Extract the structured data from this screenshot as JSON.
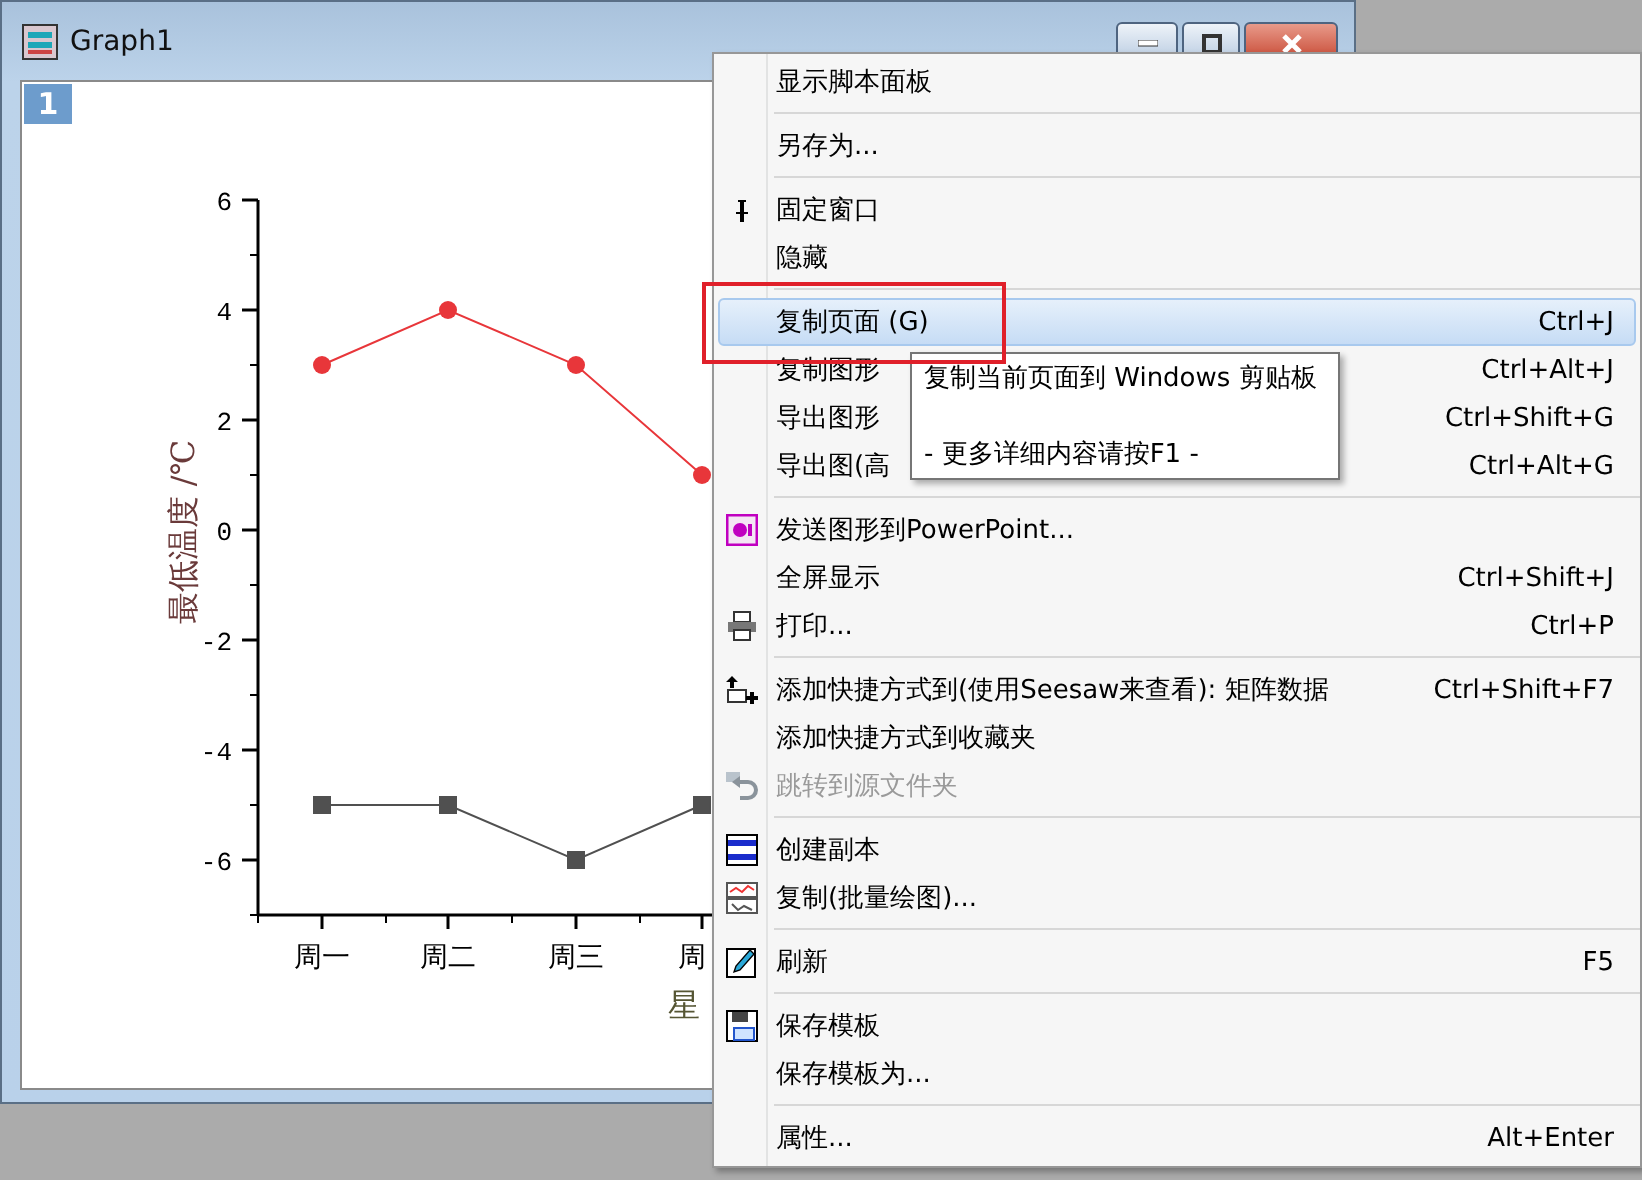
{
  "window": {
    "title": "Graph1",
    "layer": "1"
  },
  "chart": {
    "chart_data": {
      "type": "line",
      "xlabel": "星",
      "ylabel": "最低温度 /℃",
      "categories": [
        "周一",
        "周二",
        "周三",
        "周"
      ],
      "series": [
        {
          "color": "#e8363a",
          "marker": "circle",
          "values": [
            3,
            4,
            3,
            1
          ]
        },
        {
          "color": "#505050",
          "marker": "square",
          "values": [
            -5,
            -5,
            -6,
            -5
          ]
        }
      ],
      "ylim": [
        -7,
        6
      ],
      "yticks": [
        -6,
        -4,
        -2,
        0,
        2,
        4,
        6
      ]
    }
  },
  "menu": {
    "sections": [
      [
        {
          "label": "显示脚本面板",
          "selected": false,
          "disabled": false
        }
      ],
      [
        {
          "label": "另存为...",
          "selected": false,
          "disabled": false
        }
      ],
      [
        {
          "label": "固定窗口",
          "selected": false,
          "disabled": false
        },
        {
          "label": "隐藏",
          "selected": false,
          "disabled": false
        }
      ],
      [
        {
          "label": "复制页面 (G)",
          "shortcut": "Ctrl+J",
          "selected": true,
          "disabled": false
        },
        {
          "label": "复制图形",
          "shortcut": "Ctrl+Alt+J",
          "selected": false,
          "disabled": false
        },
        {
          "label": "导出图形",
          "shortcut": "Ctrl+Shift+G",
          "selected": false,
          "disabled": false
        },
        {
          "label": "导出图(高",
          "shortcut": "Ctrl+Alt+G",
          "selected": false,
          "disabled": false
        }
      ],
      [
        {
          "label": "发送图形到PowerPoint...",
          "selected": false,
          "disabled": false
        },
        {
          "label": "全屏显示",
          "shortcut": "Ctrl+Shift+J",
          "selected": false,
          "disabled": false
        },
        {
          "label": "打印...",
          "shortcut": "Ctrl+P",
          "selected": false,
          "disabled": false
        }
      ],
      [
        {
          "label": "添加快捷方式到(使用Seesaw来查看): 矩阵数据",
          "shortcut": "Ctrl+Shift+F7",
          "selected": false,
          "disabled": false
        },
        {
          "label": "添加快捷方式到收藏夹",
          "selected": false,
          "disabled": false
        },
        {
          "label": "跳转到源文件夹",
          "selected": false,
          "disabled": true
        }
      ],
      [
        {
          "label": "创建副本",
          "selected": false,
          "disabled": false
        },
        {
          "label": "复制(批量绘图)...",
          "selected": false,
          "disabled": false
        }
      ],
      [
        {
          "label": "刷新",
          "shortcut": "F5",
          "selected": false,
          "disabled": false
        }
      ],
      [
        {
          "label": "保存模板",
          "selected": false,
          "disabled": false
        },
        {
          "label": "保存模板为...",
          "selected": false,
          "disabled": false
        }
      ],
      [
        {
          "label": "属性...",
          "shortcut": "Alt+Enter",
          "selected": false,
          "disabled": false
        }
      ]
    ]
  },
  "tooltip": {
    "lines": [
      "复制当前页面到 Windows 剪贴板",
      "- 更多详细内容请按F1 -"
    ]
  }
}
